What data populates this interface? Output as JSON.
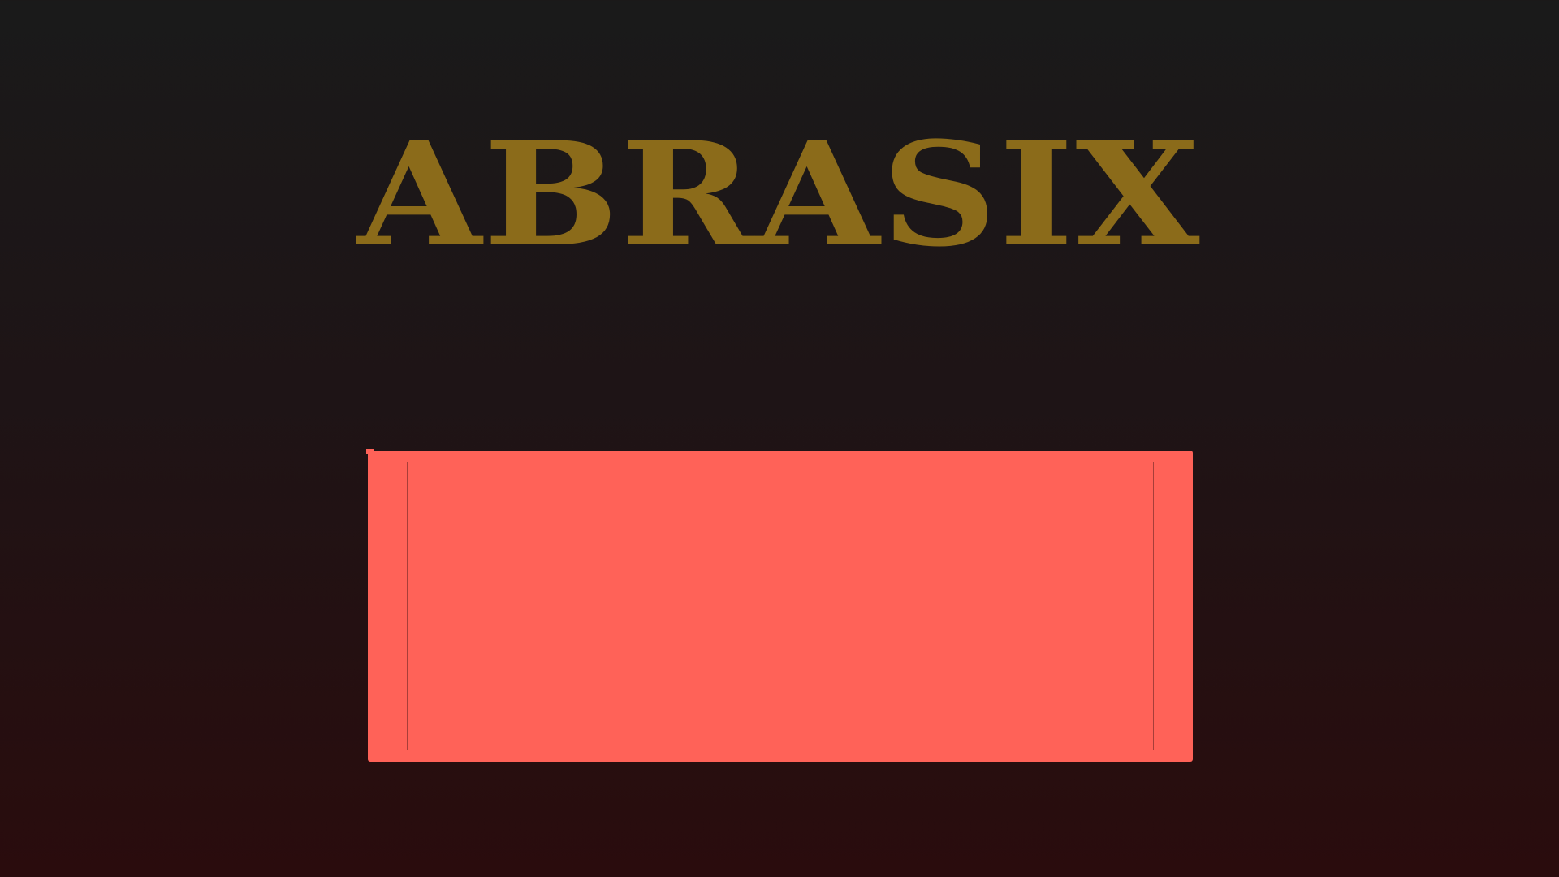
{
  "game": {
    "title": "ABRASIX"
  },
  "colors": {
    "title": "#8b6b1a",
    "panel": "#ff6258",
    "background_top": "#1a1a1a",
    "background_bottom": "#2a0c0d"
  }
}
